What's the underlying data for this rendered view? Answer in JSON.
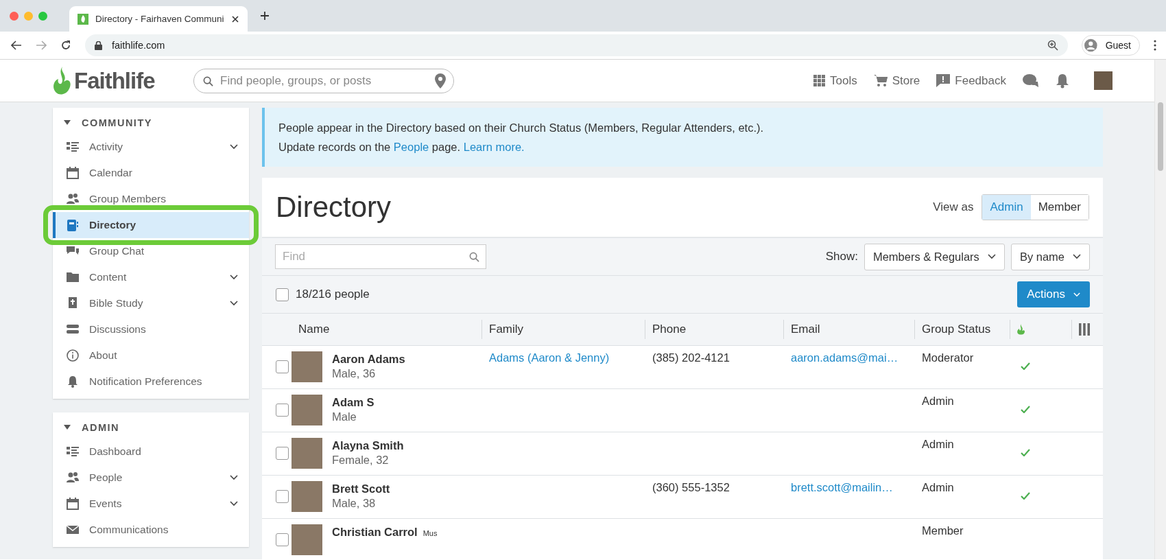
{
  "browser": {
    "tab_title": "Directory - Fairhaven Communi",
    "url": "faithlife.com",
    "profile": "Guest"
  },
  "header": {
    "logo": "Faithlife",
    "search_placeholder": "Find people, groups, or posts",
    "nav": [
      {
        "label": "Tools",
        "kind": "grid"
      },
      {
        "label": "Store",
        "kind": "cart"
      },
      {
        "label": "Feedback",
        "kind": "feedback"
      }
    ]
  },
  "sidebar": [
    {
      "title": "COMMUNITY",
      "expanded": true,
      "items": [
        {
          "label": "Activity",
          "expandable": true,
          "selected": false,
          "highlighted": false
        },
        {
          "label": "Calendar",
          "expandable": false,
          "selected": false,
          "highlighted": false
        },
        {
          "label": "Group Members",
          "expandable": false,
          "selected": false,
          "highlighted": false
        },
        {
          "label": "Directory",
          "expandable": false,
          "selected": true,
          "highlighted": true
        },
        {
          "label": "Group Chat",
          "expandable": false,
          "selected": false,
          "highlighted": false
        },
        {
          "label": "Content",
          "expandable": true,
          "selected": false,
          "highlighted": false
        },
        {
          "label": "Bible Study",
          "expandable": true,
          "selected": false,
          "highlighted": false
        },
        {
          "label": "Discussions",
          "expandable": false,
          "selected": false,
          "highlighted": false
        },
        {
          "label": "About",
          "expandable": false,
          "selected": false,
          "highlighted": false
        },
        {
          "label": "Notification Preferences",
          "expandable": false,
          "selected": false,
          "highlighted": false
        }
      ]
    },
    {
      "title": "ADMIN",
      "expanded": true,
      "items": [
        {
          "label": "Dashboard",
          "expandable": false,
          "selected": false,
          "highlighted": false
        },
        {
          "label": "People",
          "expandable": true,
          "selected": false,
          "highlighted": false
        },
        {
          "label": "Events",
          "expandable": true,
          "selected": false,
          "highlighted": false
        },
        {
          "label": "Communications",
          "expandable": false,
          "selected": false,
          "highlighted": false
        }
      ]
    }
  ],
  "banner": {
    "line1": "People appear in the Directory based on their Church Status (Members, Regular Attenders, etc.).",
    "line2_before": "Update records on the",
    "line2_link": "People",
    "line2_after": "page.",
    "learn_more": "Learn more."
  },
  "directory": {
    "title": "Directory",
    "view_as_label": "View as",
    "view_options": [
      {
        "label": "Admin",
        "selected": true
      },
      {
        "label": "Member",
        "selected": false
      }
    ],
    "find_placeholder": "Find",
    "show_label": "Show:",
    "show_value": "Members & Regulars",
    "sort_value": "By name",
    "count": "18/216 people",
    "all_selected": false,
    "actions": "Actions",
    "columns": [
      "Name",
      "Family",
      "Phone",
      "Email",
      "Group Status"
    ],
    "rows": [
      {
        "name": "Aaron Adams",
        "detail": "Male, 36",
        "family": "Adams (Aaron & Jenny)",
        "phone": "(385) 202-4121",
        "email": "aaron.adams@mai…",
        "status": "Moderator",
        "verified": true,
        "checked": false
      },
      {
        "name": "Adam S",
        "detail": "Male",
        "status": "Admin",
        "verified": true,
        "checked": false
      },
      {
        "name": "Alayna Smith",
        "detail": "Female, 32",
        "status": "Admin",
        "verified": true,
        "checked": false
      },
      {
        "name": "Brett Scott",
        "detail": "Male, 38",
        "phone": "(360) 555-1352",
        "email": "brett.scott@mailin…",
        "status": "Admin",
        "verified": true,
        "checked": false
      },
      {
        "name": "Christian Carrol",
        "tag": "Mus",
        "status": "Member",
        "checked": false
      }
    ]
  }
}
